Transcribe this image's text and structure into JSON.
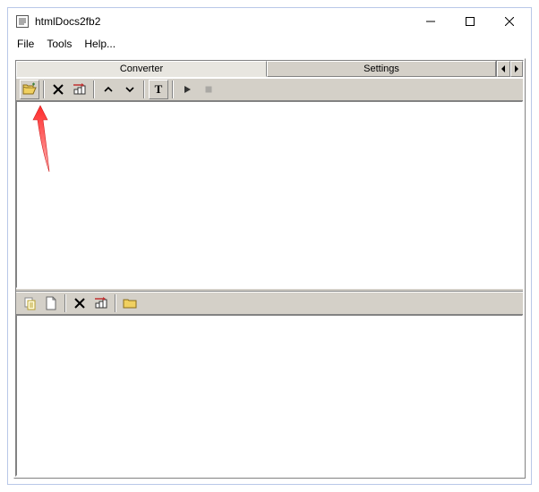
{
  "window": {
    "title": "htmlDocs2fb2"
  },
  "menu": {
    "file": "File",
    "tools": "Tools",
    "help": "Help..."
  },
  "tabs": {
    "converter": "Converter",
    "settings": "Settings"
  },
  "toolbar_top": {
    "open": "open-folder",
    "delete": "delete-x",
    "queue": "queue-files",
    "up": "move-up",
    "down": "move-down",
    "text": "T",
    "play": "play",
    "stop": "stop"
  },
  "toolbar_bottom": {
    "copy": "copy-doc",
    "new": "new-doc",
    "delete": "delete-x",
    "queue": "queue-files",
    "folder": "folder"
  }
}
